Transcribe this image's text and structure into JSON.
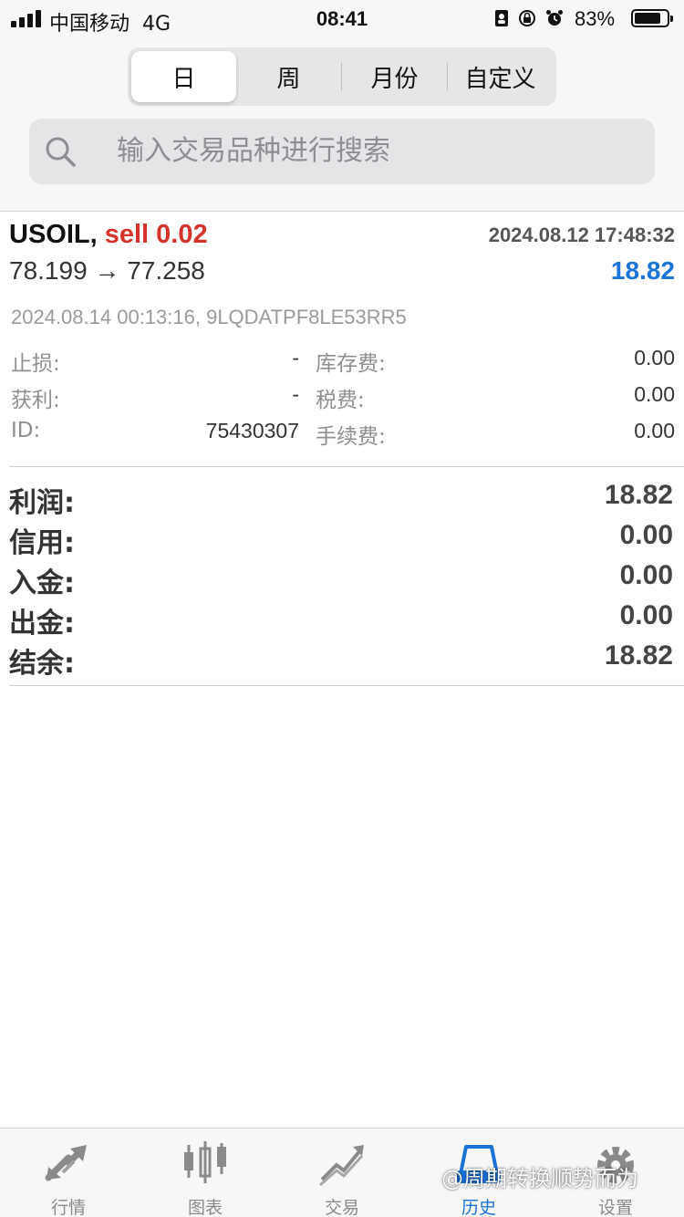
{
  "status_bar": {
    "carrier": "中国移动",
    "network": "4G",
    "time": "08:41",
    "battery_percent": "83%",
    "battery_level": 0.83
  },
  "period_tabs": [
    {
      "label": "日",
      "active": true
    },
    {
      "label": "周",
      "active": false
    },
    {
      "label": "月份",
      "active": false
    },
    {
      "label": "自定义",
      "active": false
    }
  ],
  "search": {
    "placeholder": "输入交易品种进行搜索"
  },
  "trade": {
    "symbol": "USOIL,",
    "side": "sell 0.02",
    "open_time": "2024.08.12 17:48:32",
    "prices": "78.199 → 77.258",
    "profit": "18.82",
    "close_info": "2024.08.14 00:13:16, 9LQDATPF8LE53RR5",
    "details": [
      {
        "label": "止损:",
        "value": "-",
        "label2": "库存费:",
        "value2": "0.00"
      },
      {
        "label": "获利:",
        "value": "-",
        "label2": "税费:",
        "value2": "0.00"
      },
      {
        "label": "ID:",
        "value": "75430307",
        "label2": "手续费:",
        "value2": "0.00"
      }
    ]
  },
  "summary": [
    {
      "label": "利润:",
      "value": "18.82"
    },
    {
      "label": "信用:",
      "value": "0.00"
    },
    {
      "label": "入金:",
      "value": "0.00"
    },
    {
      "label": "出金:",
      "value": "0.00"
    },
    {
      "label": "结余:",
      "value": "18.82"
    }
  ],
  "tabbar": [
    {
      "label": "行情",
      "icon": "quotes-arrows-icon",
      "active": false
    },
    {
      "label": "图表",
      "icon": "candlestick-chart-icon",
      "active": false
    },
    {
      "label": "交易",
      "icon": "trade-line-icon",
      "active": false
    },
    {
      "label": "历史",
      "icon": "history-folder-icon",
      "active": true
    },
    {
      "label": "设置",
      "icon": "gear-icon",
      "active": false
    }
  ],
  "watermark": "@周期转换顺势而为",
  "colors": {
    "accent_blue": "#1a73d9",
    "sell_red": "#d6322a"
  }
}
